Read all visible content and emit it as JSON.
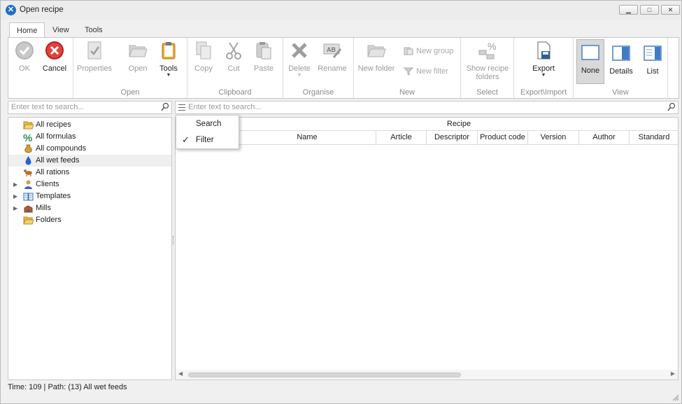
{
  "window": {
    "title": "Open recipe",
    "minimize": "▁",
    "maximize": "□",
    "close": "✕"
  },
  "ribbon": {
    "tabs": [
      "Home",
      "View",
      "Tools"
    ],
    "active_tab": "Home",
    "groups": {
      "ok_cancel": {
        "ok": "OK",
        "cancel": "Cancel"
      },
      "open": {
        "label": "Open",
        "properties": "Properties",
        "open": "Open",
        "tools": "Tools"
      },
      "clipboard": {
        "label": "Clipboard",
        "copy": "Copy",
        "cut": "Cut",
        "paste": "Paste"
      },
      "organise": {
        "label": "Organise",
        "delete": "Delete",
        "rename": "Rename"
      },
      "new": {
        "label": "New",
        "new_folder": "New folder",
        "new_group": "New group",
        "new_filter": "New filter"
      },
      "select": {
        "label": "Select",
        "show_recipe_folders_1": "Show recipe",
        "show_recipe_folders_2": "folders"
      },
      "export_import": {
        "label": "Export\\Import",
        "export": "Export"
      },
      "view": {
        "label": "View",
        "none": "None",
        "details": "Details",
        "list": "List"
      }
    }
  },
  "left_pane": {
    "search_placeholder": "Enter text to search...",
    "tree": [
      {
        "label": "All recipes",
        "icon": "folder-open-icon",
        "expandable": false
      },
      {
        "label": "All formulas",
        "icon": "percent-icon",
        "expandable": false
      },
      {
        "label": "All compounds",
        "icon": "sack-icon",
        "expandable": false
      },
      {
        "label": "All wet feeds",
        "icon": "drop-icon",
        "expandable": false,
        "selected": true
      },
      {
        "label": "All rations",
        "icon": "animals-icon",
        "expandable": false
      },
      {
        "label": "Clients",
        "icon": "person-icon",
        "expandable": true
      },
      {
        "label": "Templates",
        "icon": "book-icon",
        "expandable": true
      },
      {
        "label": "Mills",
        "icon": "mill-icon",
        "expandable": true
      },
      {
        "label": "Folders",
        "icon": "folder-open-icon",
        "expandable": false
      }
    ]
  },
  "right_pane": {
    "search_placeholder": "Enter text to search...",
    "band_header": "Recipe",
    "columns": [
      "Name",
      "Article",
      "Descriptor",
      "Product code",
      "Version",
      "Author",
      "Standard"
    ]
  },
  "search_menu": {
    "items": [
      {
        "label": "Search",
        "checked": false
      },
      {
        "label": "Filter",
        "checked": true
      }
    ],
    "check_glyph": "✓"
  },
  "status_bar": {
    "text": "Time: 109 | Path: (13) All wet feeds"
  },
  "colors": {
    "window_bg": "#f0f0f0",
    "ribbon_bg": "#ffffff",
    "disabled_text": "#9b9b9b",
    "cancel_red": "#d9302c",
    "app_blue": "#1f6fc7"
  }
}
